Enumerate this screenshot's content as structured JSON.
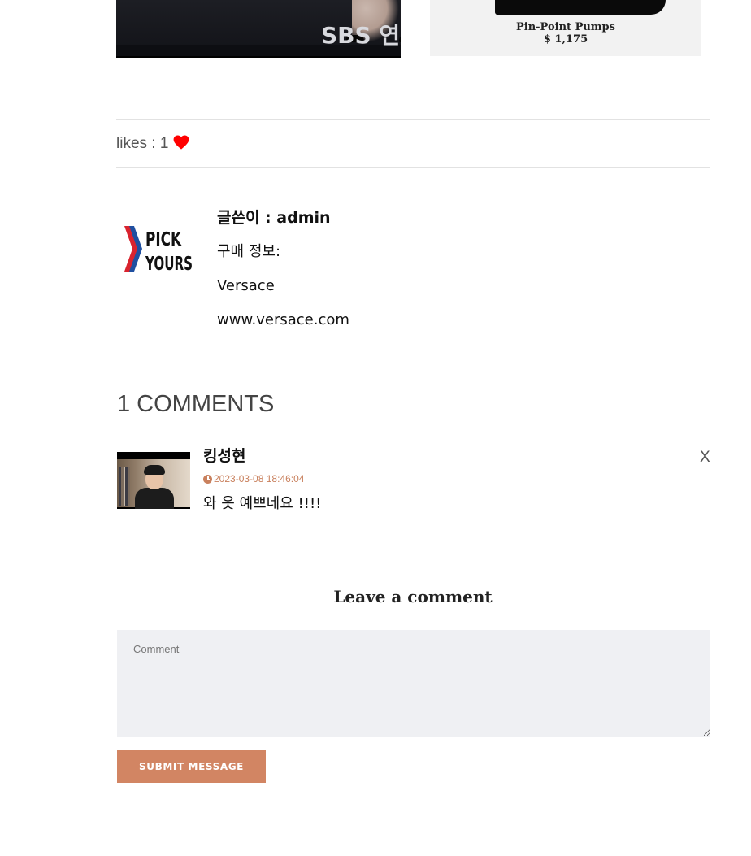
{
  "gallery": {
    "left_caption": "SBS 연",
    "right_product_name": "Pin-Point Pumps",
    "right_product_price": "$ 1,175"
  },
  "likes": {
    "label": "likes : 1",
    "icon": "heart-icon",
    "icon_color": "#ff0000"
  },
  "author": {
    "logo_line1": "PICK",
    "logo_line2": "YOURS",
    "writer": "글쓴이 : admin",
    "purchase_label": "구매 정보:",
    "brand": "Versace",
    "website": "www.versace.com"
  },
  "comments": {
    "title": "1 COMMENTS",
    "items": [
      {
        "name": "킹성현",
        "date": "2023-03-08 18:46:04",
        "text": "와 옷 예쁘네요 !!!!",
        "delete_label": "X"
      }
    ]
  },
  "form": {
    "title": "Leave a comment",
    "placeholder": "Comment",
    "value": "",
    "submit_label": "SUBMIT MESSAGE"
  },
  "colors": {
    "accent": "#d28563",
    "date": "#c9805d",
    "textarea_bg": "#eff0f3"
  }
}
